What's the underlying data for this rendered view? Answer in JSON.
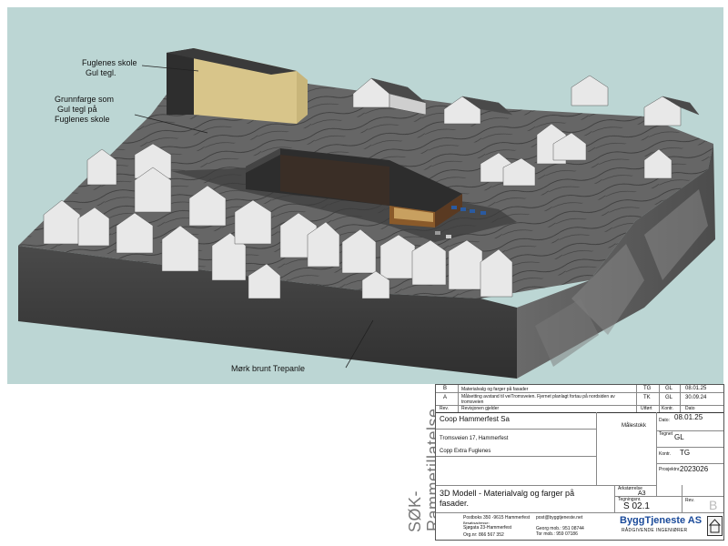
{
  "annotations": {
    "school_title": "Fuglenes skole",
    "school_sub": "Gul tegl.",
    "ground_1": "Grunnfarge som",
    "ground_2": "Gul tegl på",
    "ground_3": "Fuglenes skole",
    "panel": "Mørk brunt Trepanle"
  },
  "side_stamp": {
    "line1": "SØK-",
    "line2": "Rammetillatelse"
  },
  "title_block": {
    "revisions": [
      {
        "rev": "B",
        "text": "Materialvalg og farger på fasader",
        "drawn": "TG",
        "checked": "GL",
        "date": "08.01.25"
      },
      {
        "rev": "A",
        "text": "Målsetting avstand til veiTromsveien. Fjernet planlagt fortau på nordsiden av",
        "text2": "tromsveien",
        "drawn": "TK",
        "checked": "GL",
        "date": "30.09.24"
      }
    ],
    "rev_header": {
      "rev": "Rev.",
      "text": "Revisjonen gjelder",
      "drawn": "Utført",
      "checked": "Kontr.",
      "date": "Dato"
    },
    "client": "Coop Hammerfest Sa",
    "address": "Tromsveien 17, Hammerfest",
    "project": "Copp Extra Fuglenes",
    "scale_label": "Målestokk",
    "date_label": "Dato:",
    "date_value": "08.01.25",
    "drawn_label": "Tegnet",
    "drawn_value": "GL",
    "checked_label": "Kontr.",
    "checked_value": "TG",
    "project_no_label": "Prosjektnr.",
    "project_no_value": "2023026",
    "drawing_title_1": "3D Modell - Materialvalg og farger på",
    "drawing_title_2": "fasader.",
    "sheet_label": "Arkstørrelse",
    "sheet_value": "A3",
    "drawing_no_label": "Tegningsnr.",
    "drawing_no_value": "S 02.1",
    "rev_label": "Rev.",
    "rev_value": "B",
    "contact_1": "Postboks 350 -9615 Hammerfest",
    "contact_1_email": "post@byggtjeneste.net",
    "contact_2_label": "Besøksadresse:",
    "contact_2": "Sjøgata 23-Hammerfest",
    "contact_3": "Georg mob.: 951 08744",
    "contact_4": "Org.nr: 866 567 352",
    "contact_5": "Tor mob.: 959 07186",
    "company_name": "ByggTjeneste AS",
    "company_sub": "RÅDGIVENDE  INGENIØRER"
  },
  "colors": {
    "sky": "#bcd6d4",
    "terrain_top": "#5f5f5f",
    "terrain_side": "#3a3a3a",
    "building_dark": "#2b2b2b",
    "school_yellow": "#d8c58a",
    "company_blue": "#1a4a9a"
  }
}
